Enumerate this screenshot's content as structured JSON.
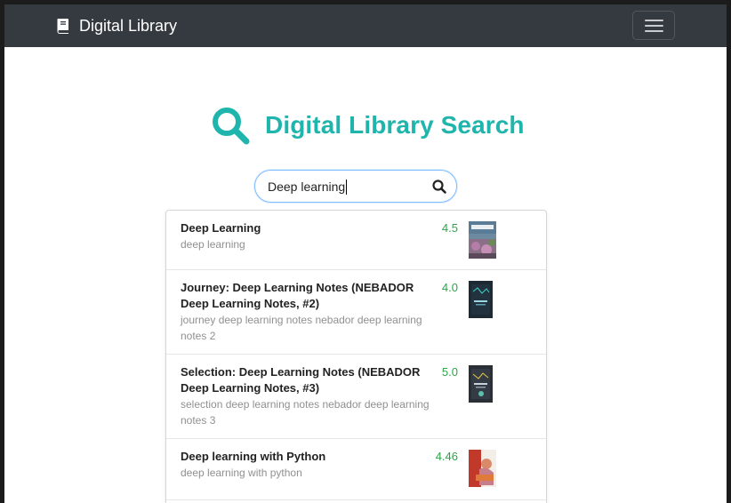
{
  "navbar": {
    "brand": "Digital Library",
    "brand_icon": "book-icon",
    "menu_icon": "hamburger-menu-icon"
  },
  "hero": {
    "title": "Digital Library Search",
    "icon": "search-icon",
    "accent_color": "#1fb5ad"
  },
  "search": {
    "value": "Deep learning",
    "button_icon": "search-icon"
  },
  "results": [
    {
      "title": "Deep Learning",
      "subtitle": "deep learning",
      "rating": "4.5"
    },
    {
      "title": "Journey: Deep Learning Notes (NEBADOR Deep Learning Notes, #2)",
      "subtitle": "journey deep learning notes nebador deep learning notes 2",
      "rating": "4.0"
    },
    {
      "title": "Selection: Deep Learning Notes (NEBADOR Deep Learning Notes, #3)",
      "subtitle": "selection deep learning notes nebador deep learning notes 3",
      "rating": "5.0"
    },
    {
      "title": "Deep learning with Python",
      "subtitle": "deep learning with python",
      "rating": "4.46"
    }
  ],
  "colors": {
    "navbar_bg": "#343a40",
    "rating": "#28a745",
    "subtitle": "#909090"
  }
}
